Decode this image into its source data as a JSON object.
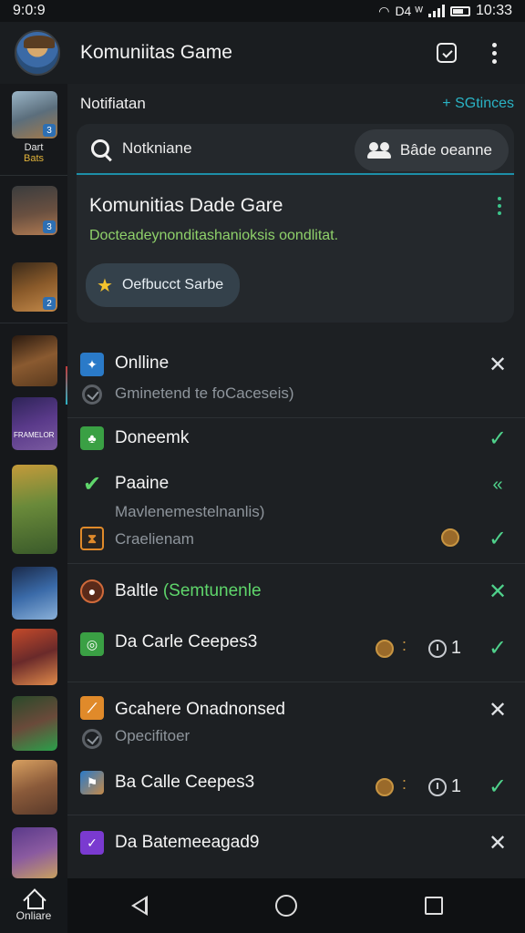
{
  "status_bar": {
    "time": "9:0:9",
    "carrier": "D4 ᵂ",
    "clock": "10:33"
  },
  "app_bar": {
    "title": "Komuniitas Game"
  },
  "sidebar": {
    "caption_line1": "Dart",
    "caption_line2": "Bats",
    "badges": [
      "3",
      "3",
      "2",
      "",
      "",
      "",
      "",
      "",
      "",
      ""
    ],
    "art_colors": [
      "#6b8a9f",
      "#5b4a3a",
      "#7a4a22",
      "#6a4a2a",
      "#3a2e5c",
      "#5a8a3a",
      "#2a4a7a",
      "#9a3a2a",
      "#2e5a3e",
      "#8a5a3a",
      "#5a3a8a"
    ],
    "art_label": "FRAMELOR"
  },
  "section": {
    "title": "Notifiatan",
    "action": "+ SGtinces"
  },
  "card": {
    "search_text": "Notkniane",
    "chip_label": "Bâde oeanne",
    "title": "Komunitias Dade Gare",
    "subtitle": "Docteadeynonditashanioksis oondlitat.",
    "button_label": "Oefbucct Sarbe"
  },
  "list": [
    {
      "label": "Onlline",
      "sub": "Gminetend te foCaceseis)",
      "icon": "blue"
    },
    {
      "label": "Doneemk",
      "icon": "green"
    },
    {
      "label": "Paaine",
      "sub": "Mavlenemestelnanlis)",
      "icon": "check"
    },
    {
      "label": "Craelienam",
      "icon": "orange"
    },
    {
      "label": "Baltle",
      "label_extra": "(Semtunenle",
      "icon": "round"
    },
    {
      "label": "Da Carle Ceepes3",
      "count": "1",
      "icon": "green2"
    },
    {
      "label": "Gcahere Onadnonsed",
      "sub": "Opecifitoer",
      "icon": "orange2"
    },
    {
      "label": "Ba Calle Ceepes3",
      "count": "1",
      "icon": "pic"
    },
    {
      "label": "Da Batemeeagad9",
      "icon": "purple"
    }
  ],
  "nav": {
    "home_label": "Onliare"
  },
  "colors": {
    "accent_teal": "#2ab3c5",
    "green": "#5fd66b",
    "bg": "#1d2023"
  }
}
